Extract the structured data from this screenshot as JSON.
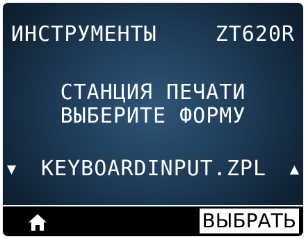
{
  "header": {
    "menu_title": "ИНСТРУМЕНТЫ",
    "model": "ZT620R"
  },
  "message": {
    "line1": "СТАНЦИЯ ПЕЧАТИ",
    "line2": "ВЫБЕРИТЕ ФОРМУ"
  },
  "selector": {
    "value": "KEYBOARDINPUT.ZPL",
    "down_arrow": "▼",
    "up_arrow": "▲"
  },
  "footer": {
    "home_icon": "home-icon",
    "select_label": "ВЫБРАТЬ"
  },
  "colors": {
    "screen_bg": "#1d3a56",
    "text": "#ffffff",
    "footer_bg": "#000000"
  }
}
